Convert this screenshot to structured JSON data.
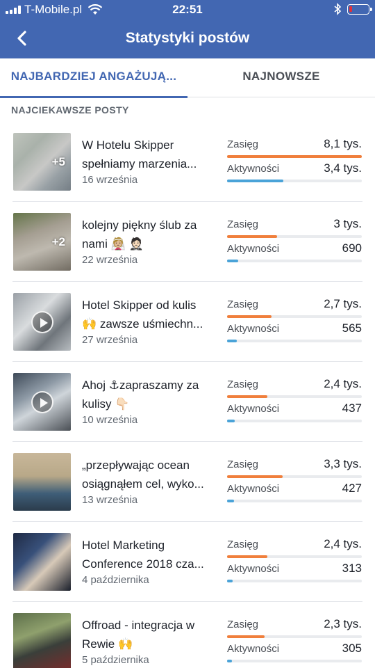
{
  "status_bar": {
    "carrier": "T-Mobile.pl",
    "time": "22:51",
    "signal_bars": 4,
    "battery_level": 0.1,
    "icons": [
      "signal-icon",
      "wifi-icon",
      "bluetooth-icon",
      "battery-icon"
    ]
  },
  "header": {
    "title": "Statystyki postów",
    "back_icon": "chevron-left-icon",
    "background": "#4267b2"
  },
  "tabs": [
    {
      "label": "NAJBARDZIEJ ANGAŻUJĄ...",
      "active": true
    },
    {
      "label": "NAJNOWSZE",
      "active": false
    }
  ],
  "section_title": "NAJCIEKAWSZE POSTY",
  "metric_labels": {
    "reach": "Zasięg",
    "activity": "Aktywności"
  },
  "colors": {
    "reach": "#f07f3c",
    "activity": "#4aa3d8",
    "accent": "#4267b2"
  },
  "posts": [
    {
      "line1": "W Hotelu Skipper",
      "line2": "spełniamy marzenia...",
      "date": "16 września",
      "thumb_badge": "+5",
      "video": false,
      "reach": "8,1 tys.",
      "activity": "3,4 tys.",
      "reach_fraction": 1.0,
      "activity_fraction": 0.42
    },
    {
      "line1": "kolejny piękny ślub za",
      "line2": "nami 👰🏼 🤵🏻",
      "date": "22 września",
      "thumb_badge": "+2",
      "video": false,
      "reach": "3 tys.",
      "activity": "690",
      "reach_fraction": 0.37,
      "activity_fraction": 0.085
    },
    {
      "line1": "Hotel Skipper od kulis",
      "line2": "🙌 zawsze uśmiechn...",
      "date": "27 września",
      "thumb_badge": "",
      "video": true,
      "reach": "2,7 tys.",
      "activity": "565",
      "reach_fraction": 0.33,
      "activity_fraction": 0.07
    },
    {
      "line1": "Ahoj ⚓zapraszamy za",
      "line2": "kulisy 👇🏻",
      "date": "10 września",
      "thumb_badge": "",
      "video": true,
      "reach": "2,4 tys.",
      "activity": "437",
      "reach_fraction": 0.3,
      "activity_fraction": 0.055
    },
    {
      "line1": "„przepływając ocean",
      "line2": "osiągnąłem cel, wyko...",
      "date": "13 września",
      "thumb_badge": "",
      "video": false,
      "reach": "3,3 tys.",
      "activity": "427",
      "reach_fraction": 0.41,
      "activity_fraction": 0.053
    },
    {
      "line1": "Hotel Marketing",
      "line2": "Conference 2018 cza...",
      "date": "4 października",
      "thumb_badge": "",
      "video": false,
      "reach": "2,4 tys.",
      "activity": "313",
      "reach_fraction": 0.3,
      "activity_fraction": 0.04
    },
    {
      "line1": "Offroad - integracja w",
      "line2": "Rewie 🙌",
      "date": "5 października",
      "thumb_badge": "",
      "video": false,
      "reach": "2,3 tys.",
      "activity": "305",
      "reach_fraction": 0.28,
      "activity_fraction": 0.038
    }
  ]
}
